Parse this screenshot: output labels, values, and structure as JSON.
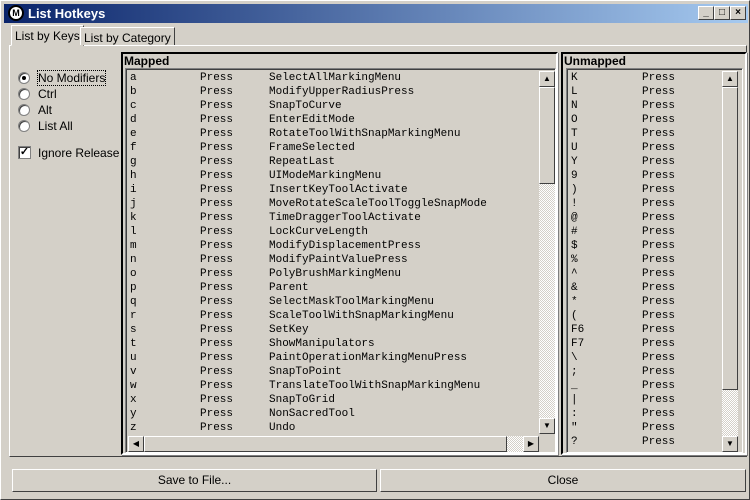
{
  "window": {
    "title": "List Hotkeys",
    "app_icon_letter": "M",
    "minimize": "_",
    "maximize": "□",
    "close": "×"
  },
  "tabs": [
    {
      "label": "List by Keys",
      "active": true
    },
    {
      "label": "List by Category",
      "active": false
    }
  ],
  "modifiers": [
    {
      "label": "No Modifiers",
      "selected": true
    },
    {
      "label": "Ctrl",
      "selected": false
    },
    {
      "label": "Alt",
      "selected": false
    },
    {
      "label": "List All",
      "selected": false
    }
  ],
  "ignore_release": {
    "label": "Ignore Release",
    "checked": true
  },
  "mapped": {
    "title": "Mapped",
    "rows": [
      [
        "a",
        "Press",
        "SelectAllMarkingMenu"
      ],
      [
        "b",
        "Press",
        "ModifyUpperRadiusPress"
      ],
      [
        "c",
        "Press",
        "SnapToCurve"
      ],
      [
        "d",
        "Press",
        "EnterEditMode"
      ],
      [
        "e",
        "Press",
        "RotateToolWithSnapMarkingMenu"
      ],
      [
        "f",
        "Press",
        "FrameSelected"
      ],
      [
        "g",
        "Press",
        "RepeatLast"
      ],
      [
        "h",
        "Press",
        "UIModeMarkingMenu"
      ],
      [
        "i",
        "Press",
        "InsertKeyToolActivate"
      ],
      [
        "j",
        "Press",
        "MoveRotateScaleToolToggleSnapMode"
      ],
      [
        "k",
        "Press",
        "TimeDraggerToolActivate"
      ],
      [
        "l",
        "Press",
        "LockCurveLength"
      ],
      [
        "m",
        "Press",
        "ModifyDisplacementPress"
      ],
      [
        "n",
        "Press",
        "ModifyPaintValuePress"
      ],
      [
        "o",
        "Press",
        "PolyBrushMarkingMenu"
      ],
      [
        "p",
        "Press",
        "Parent"
      ],
      [
        "q",
        "Press",
        "SelectMaskToolMarkingMenu"
      ],
      [
        "r",
        "Press",
        "ScaleToolWithSnapMarkingMenu"
      ],
      [
        "s",
        "Press",
        "SetKey"
      ],
      [
        "t",
        "Press",
        "ShowManipulators"
      ],
      [
        "u",
        "Press",
        "PaintOperationMarkingMenuPress"
      ],
      [
        "v",
        "Press",
        "SnapToPoint"
      ],
      [
        "w",
        "Press",
        "TranslateToolWithSnapMarkingMenu"
      ],
      [
        "x",
        "Press",
        "SnapToGrid"
      ],
      [
        "y",
        "Press",
        "NonSacredTool"
      ],
      [
        "z",
        "Press",
        "Undo"
      ]
    ]
  },
  "unmapped": {
    "title": "Unmapped",
    "rows": [
      [
        "K",
        "Press"
      ],
      [
        "L",
        "Press"
      ],
      [
        "N",
        "Press"
      ],
      [
        "O",
        "Press"
      ],
      [
        "T",
        "Press"
      ],
      [
        "U",
        "Press"
      ],
      [
        "Y",
        "Press"
      ],
      [
        "9",
        "Press"
      ],
      [
        ")",
        "Press"
      ],
      [
        "!",
        "Press"
      ],
      [
        "@",
        "Press"
      ],
      [
        "#",
        "Press"
      ],
      [
        "$",
        "Press"
      ],
      [
        "%",
        "Press"
      ],
      [
        "^",
        "Press"
      ],
      [
        "&",
        "Press"
      ],
      [
        "*",
        "Press"
      ],
      [
        "(",
        "Press"
      ],
      [
        "F6",
        "Press"
      ],
      [
        "F7",
        "Press"
      ],
      [
        "\\",
        "Press"
      ],
      [
        ";",
        "Press"
      ],
      [
        "_",
        "Press"
      ],
      [
        "|",
        "Press"
      ],
      [
        ":",
        "Press"
      ],
      [
        "\"",
        "Press"
      ],
      [
        "?",
        "Press"
      ]
    ]
  },
  "buttons": {
    "save": "Save to File...",
    "close": "Close"
  }
}
